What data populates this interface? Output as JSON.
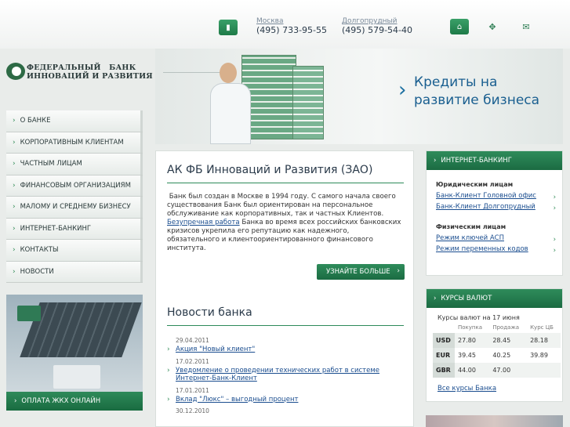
{
  "header": {
    "phone_icon": "mobile-phone-icon",
    "offices": [
      {
        "city": "Москва",
        "phone": "(495) 733-95-55"
      },
      {
        "city": "Долгопрудный",
        "phone": "(495) 579-54-40"
      }
    ],
    "icons": [
      "home-icon",
      "sitemap-icon",
      "mail-icon"
    ]
  },
  "logo": {
    "line1": "ФЕДЕРАЛЬНЫЙ   БАНК",
    "line2": "ИННОВАЦИЙ И РАЗВИТИЯ"
  },
  "banner": {
    "text_line1": "Кредиты на",
    "text_line2": "развитие бизнеса"
  },
  "menu": {
    "items": [
      "О БАНКЕ",
      "КОРПОРАТИВНЫМ КЛИЕНТАМ",
      "ЧАСТНЫМ ЛИЦАМ",
      "ФИНАНСОВЫМ ОРГАНИЗАЦИЯМ",
      "МАЛОМУ И СРЕДНЕМУ БИЗНЕСУ",
      "ИНТЕРНЕТ-БАНКИНГ",
      "КОНТАКТЫ",
      "НОВОСТИ"
    ]
  },
  "promo": {
    "label": "ОПЛАТА ЖКХ ОНЛАЙН"
  },
  "about": {
    "title": "АК ФБ Инноваций и Развития (ЗАО)",
    "text_part1": " Банк был создан в Москве в 1994 году. С самого начала своего существования Банк был ориентирован на персональное обслуживание как корпоративных, так и частных Клиентов.",
    "link_text": "Безупречная работа",
    "text_part2": " Банка во время всех российских банковских кризисов укрепила его репутацию как надежного, обязательного и клиентоориентированного финансового института.",
    "more_button": "УЗНАЙТЕ БОЛЬШЕ"
  },
  "news": {
    "title": "Новости банка",
    "items": [
      {
        "date": "29.04.2011",
        "text": "Акция \"Новый клиент\""
      },
      {
        "date": "17.02.2011",
        "text": "Уведомление о проведении технических работ в системе Интернет-Банк-Клиент"
      },
      {
        "date": "17.01.2011",
        "text": "Вклад \"Люкс\" – выгодный процент"
      },
      {
        "date": "30.12.2010",
        "text": ""
      }
    ]
  },
  "internet_banking": {
    "title": "ИНТЕРНЕТ-БАНКИНГ",
    "legal_heading": "Юридическим лицам",
    "legal_links": [
      "Банк-Клиент Головной офис",
      "Банк-Клиент Долгопрудный"
    ],
    "private_heading": "Физическим лицам",
    "private_links": [
      "Режим ключей АСП",
      "Режим переменных кодов"
    ]
  },
  "rates": {
    "title": "КУРСЫ ВАЛЮТ",
    "caption": "Курсы валют на 17 июня",
    "columns": [
      "",
      "Покупка",
      "Продажа",
      "Курс ЦБ"
    ],
    "rows": [
      {
        "cur": "USD",
        "buy": "27.80",
        "sell": "28.45",
        "cb": "28.18"
      },
      {
        "cur": "EUR",
        "buy": "39.45",
        "sell": "40.25",
        "cb": "39.89"
      },
      {
        "cur": "GBR",
        "buy": "44.00",
        "sell": "47.00",
        "cb": ""
      }
    ],
    "all_link": "Все курсы Банка"
  }
}
